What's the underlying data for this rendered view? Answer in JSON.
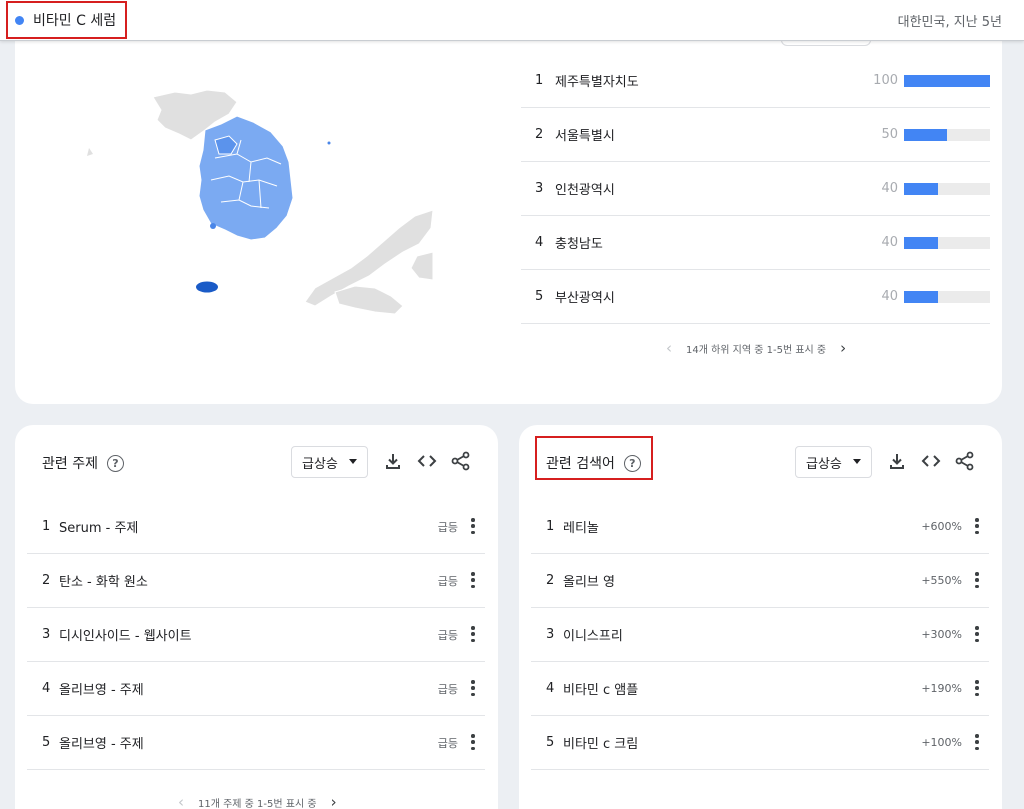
{
  "header": {
    "term": "비타민 C 세럼",
    "context": "대한민국, 지난 5년",
    "series_color": "#4285f4"
  },
  "region_map": {
    "regions": [
      {
        "rank": "1",
        "name": "제주특별자치도",
        "value": "100",
        "score": 100
      },
      {
        "rank": "2",
        "name": "서울특별시",
        "value": "50",
        "score": 50
      },
      {
        "rank": "3",
        "name": "인천광역시",
        "value": "40",
        "score": 40
      },
      {
        "rank": "4",
        "name": "충청남도",
        "value": "40",
        "score": 40
      },
      {
        "rank": "5",
        "name": "부산광역시",
        "value": "40",
        "score": 40
      }
    ],
    "pagination": "14개 하위 지역 중 1-5번 표시 중"
  },
  "related_topics": {
    "title": "관련 주제",
    "filter": "급상승",
    "items": [
      {
        "rank": "1",
        "name": "Serum - 주제",
        "value": "급등"
      },
      {
        "rank": "2",
        "name": "탄소 - 화학 원소",
        "value": "급등"
      },
      {
        "rank": "3",
        "name": "디시인사이드 - 웹사이트",
        "value": "급등"
      },
      {
        "rank": "4",
        "name": "올리브영 - 주제",
        "value": "급등"
      },
      {
        "rank": "5",
        "name": "올리브영 - 주제",
        "value": "급등"
      }
    ],
    "pagination": "11개 주제 중 1-5번 표시 중"
  },
  "related_queries": {
    "title": "관련 검색어",
    "filter": "급상승",
    "items": [
      {
        "rank": "1",
        "name": "레티놀",
        "value": "+600%"
      },
      {
        "rank": "2",
        "name": "올리브 영",
        "value": "+550%"
      },
      {
        "rank": "3",
        "name": "이니스프리",
        "value": "+300%"
      },
      {
        "rank": "4",
        "name": "비타민 c 앰플",
        "value": "+190%"
      },
      {
        "rank": "5",
        "name": "비타민 c 크림",
        "value": "+100%"
      }
    ]
  },
  "icons": {
    "help": "?",
    "download": "download-icon",
    "embed": "embed-code-icon",
    "share": "share-icon",
    "more": "more-vert-icon"
  }
}
